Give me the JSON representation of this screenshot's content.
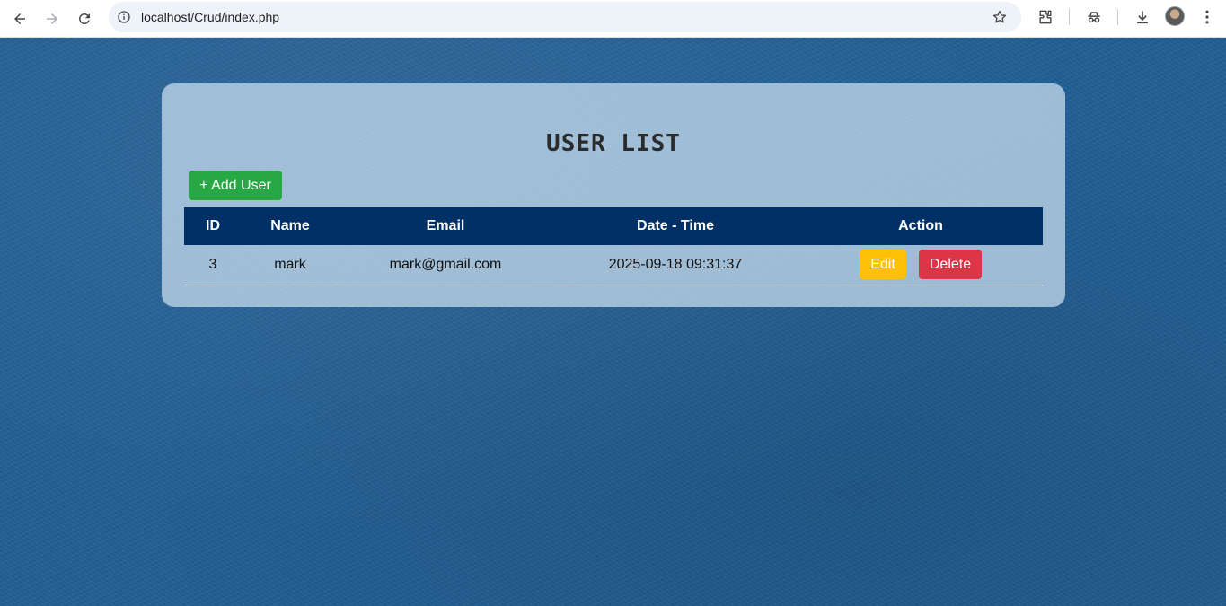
{
  "browser": {
    "url": "localhost/Crud/index.php",
    "icons": [
      "back-icon",
      "forward-icon",
      "reload-icon",
      "site-info-icon",
      "bookmark-star-icon",
      "extensions-icon",
      "incognito-icon",
      "download-icon",
      "avatar",
      "menu-icon"
    ]
  },
  "page": {
    "title": "USER LIST",
    "add_button": "+ Add User",
    "table": {
      "headers": [
        "ID",
        "Name",
        "Email",
        "Date - Time",
        "Action"
      ],
      "rows": [
        {
          "id": "3",
          "name": "mark",
          "email": "mark@gmail.com",
          "datetime": "2025-09-18 09:31:37",
          "edit_label": "Edit",
          "delete_label": "Delete"
        }
      ]
    }
  },
  "colors": {
    "header_bg": "#003066",
    "add_button": "#28a745",
    "edit_button": "#ffc107",
    "delete_button": "#dc3545",
    "background": "#215f95"
  }
}
